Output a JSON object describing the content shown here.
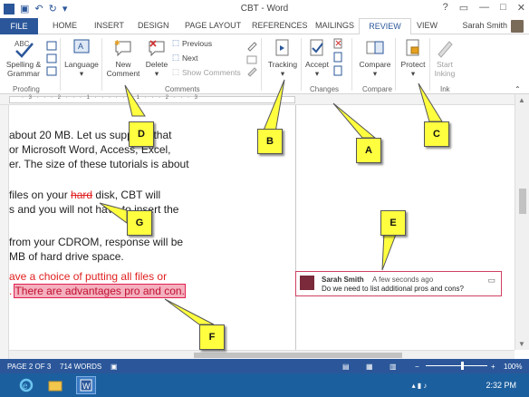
{
  "window": {
    "title": "CBT - Word",
    "controls": [
      "?",
      "▭",
      "—",
      "□",
      "✕"
    ]
  },
  "tabs": {
    "file": "FILE",
    "items": [
      "HOME",
      "INSERT",
      "DESIGN",
      "PAGE LAYOUT",
      "REFERENCES",
      "MAILINGS",
      "REVIEW",
      "VIEW"
    ],
    "active": "REVIEW",
    "user": "Sarah Smith"
  },
  "ribbon": {
    "proofing": {
      "label": "Proofing",
      "spelling": "Spelling &",
      "grammar": "Grammar"
    },
    "language": {
      "label": "Language"
    },
    "comments": {
      "label": "Comments",
      "new_comment_1": "New",
      "new_comment_2": "Comment",
      "delete": "Delete",
      "previous": "Previous",
      "next": "Next",
      "show_comments": "Show Comments"
    },
    "tracking": {
      "label": "Tracking"
    },
    "changes": {
      "label": "Changes",
      "accept": "Accept"
    },
    "compare": {
      "label": "Compare",
      "button": "Compare"
    },
    "protect": {
      "button": "Protect"
    },
    "ink": {
      "label": "Ink",
      "start_1": "Start",
      "start_2": "Inking"
    }
  },
  "ruler": {
    "numbers": "· 3 · · · 2 · · · 1 · · · · · · 1 · · · 2 · · · 3"
  },
  "document": {
    "lines": [
      "about 20 MB. Let us suppose that",
      "or Microsoft Word, Access, Excel,",
      "er. The size of these tutorials is about",
      "files on your ",
      "hard",
      " disk, CBT will",
      "s and you will not have to insert the",
      "from your CDROM, response will be",
      "MB of hard drive space.",
      "ave a choice of putting all files or",
      ". ",
      "There are advantages pro and con."
    ]
  },
  "comment": {
    "author": "Sarah Smith",
    "time": "A few seconds ago",
    "text": "Do we need to list additional pros and cons?"
  },
  "status": {
    "page": "PAGE 2 OF 3",
    "words": "714 WORDS",
    "zoom": "100%",
    "zoom_percent": 100
  },
  "taskbar": {
    "clock": "2:32 PM"
  },
  "callouts": [
    "A",
    "B",
    "C",
    "D",
    "E",
    "F",
    "G"
  ],
  "colors": {
    "accent": "#2b579a",
    "revision_red": "#e02020",
    "highlight": "#f4b0bf",
    "callout_yellow": "#ffff40",
    "taskbar": "#1c5f9e"
  }
}
